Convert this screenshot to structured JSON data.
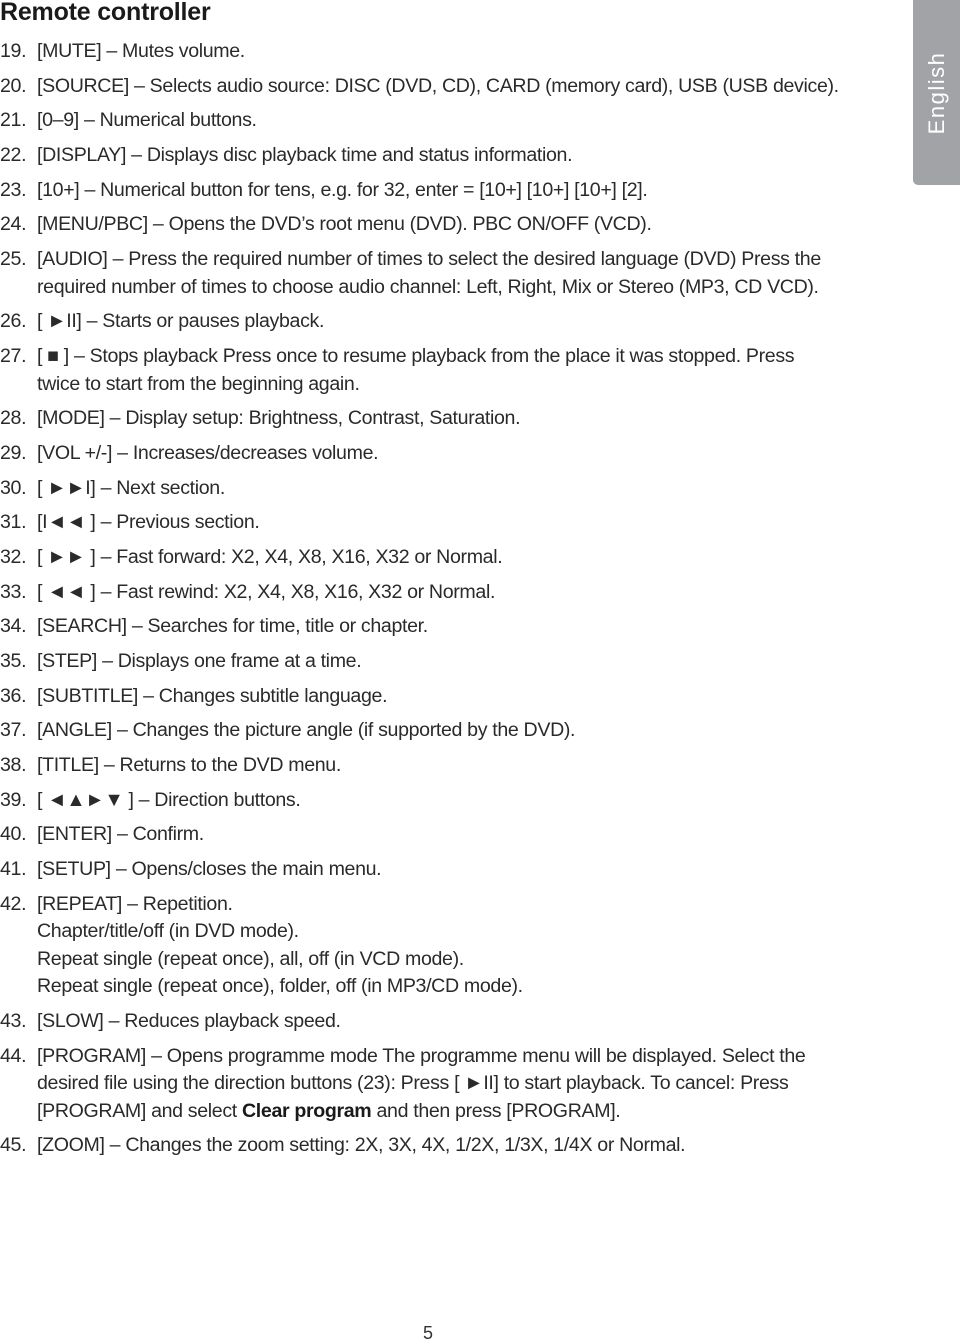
{
  "page": {
    "title": "Remote controller",
    "language_tab": "English",
    "page_number": "5"
  },
  "items": [
    {
      "num": "19.",
      "key": "[MUTE]",
      "dash": " – ",
      "text": "Mutes volume."
    },
    {
      "num": "20.",
      "key": "[SOURCE]",
      "dash": " – ",
      "text": "Selects audio source: DISC (DVD, CD), CARD (memory card), USB (USB device)."
    },
    {
      "num": "21.",
      "key": "[0–9]",
      "dash": " – ",
      "text": "Numerical buttons."
    },
    {
      "num": "22.",
      "key": "[DISPLAY]",
      "dash": " – ",
      "text": "Displays disc playback time and status information."
    },
    {
      "num": "23.",
      "key": "[10+]",
      "dash": " – ",
      "text": "Numerical button for tens, e.g. for 32, enter = [10+] [10+] [10+] [2]."
    },
    {
      "num": "24.",
      "key": "[MENU/PBC]",
      "dash": " – ",
      "text": "Opens the DVD’s root menu (DVD). PBC ON/OFF (VCD)."
    },
    {
      "num": "25.",
      "key": "[AUDIO]",
      "dash": " – ",
      "text": "Press the required number of times to select the desired language (DVD) Press the required number of times to choose audio channel: Left, Right, Mix or Stereo (MP3, CD VCD)."
    },
    {
      "num": "26.",
      "key": "[ ►II]",
      "dash": " – ",
      "text": "Starts or pauses playback."
    },
    {
      "num": "27.",
      "key": "[ ■ ]",
      "dash": " – ",
      "text": "Stops playback Press once to resume playback from the place it was stopped. Press twice to start from the beginning again."
    },
    {
      "num": "28.",
      "key": "[MODE]",
      "dash": " – ",
      "text": "Display setup: Brightness, Contrast, Saturation."
    },
    {
      "num": "29.",
      "key": "[VOL +/-]",
      "dash": " – ",
      "text": "Increases/decreases volume."
    },
    {
      "num": "30.",
      "key": "[ ►►I]",
      "dash": " – ",
      "text": "Next section."
    },
    {
      "num": "31.",
      "key": "[I◄◄ ]",
      "dash": " – ",
      "text": "Previous section."
    },
    {
      "num": "32.",
      "key": "[ ►► ]",
      "dash": " – ",
      "text": "Fast forward: X2, X4, X8, X16, X32 or Normal."
    },
    {
      "num": "33.",
      "key": "[ ◄◄ ]",
      "dash": " – ",
      "text": "Fast rewind: X2, X4, X8, X16, X32 or Normal."
    },
    {
      "num": "34.",
      "key": "[SEARCH]",
      "dash": " – ",
      "text": "Searches for time, title or chapter."
    },
    {
      "num": "35.",
      "key": "[STEP]",
      "dash": " – ",
      "text": "Displays one frame at a time."
    },
    {
      "num": "36.",
      "key": "[SUBTITLE]",
      "dash": " – ",
      "text": "Changes subtitle language."
    },
    {
      "num": "37.",
      "key": "[ANGLE]",
      "dash": " – ",
      "text": "Changes the picture angle (if supported by the DVD)."
    },
    {
      "num": "38.",
      "key": "[TITLE]",
      "dash": " – ",
      "text": "Returns to the DVD menu."
    },
    {
      "num": "39.",
      "key": "[ ◄▲►▼ ]",
      "dash": " – ",
      "text": "Direction buttons."
    },
    {
      "num": "40.",
      "key": "[ENTER]",
      "dash": " – ",
      "text": "Confirm."
    },
    {
      "num": "41.",
      "key": "[SETUP]",
      "dash": " – ",
      "text": "Opens/closes the main menu."
    },
    {
      "num": "42.",
      "key": "[REPEAT]",
      "dash": " – ",
      "text": "Repetition.",
      "sublines": [
        "Chapter/title/off (in DVD mode).",
        "Repeat single (repeat once), all, off (in VCD mode).",
        "Repeat single (repeat once), folder, off (in MP3/CD mode)."
      ]
    },
    {
      "num": "43.",
      "key": "[SLOW]",
      "dash": " – ",
      "text": "Reduces playback speed."
    },
    {
      "num": "44.",
      "key": "[PROGRAM]",
      "dash": " – ",
      "text": "Opens programme mode The programme menu will be displayed. Select the desired file using the direction buttons (23): Press [ ►II] to start playback. To cancel: Press [PROGRAM] and select ",
      "bold": "Clear program",
      "text_after": " and then press [PROGRAM]."
    },
    {
      "num": "45.",
      "key": "[ZOOM]",
      "dash": " – ",
      "text": "Changes the zoom setting: 2X, 3X, 4X, 1/2X, 1/3X, 1/4X or Normal."
    }
  ]
}
